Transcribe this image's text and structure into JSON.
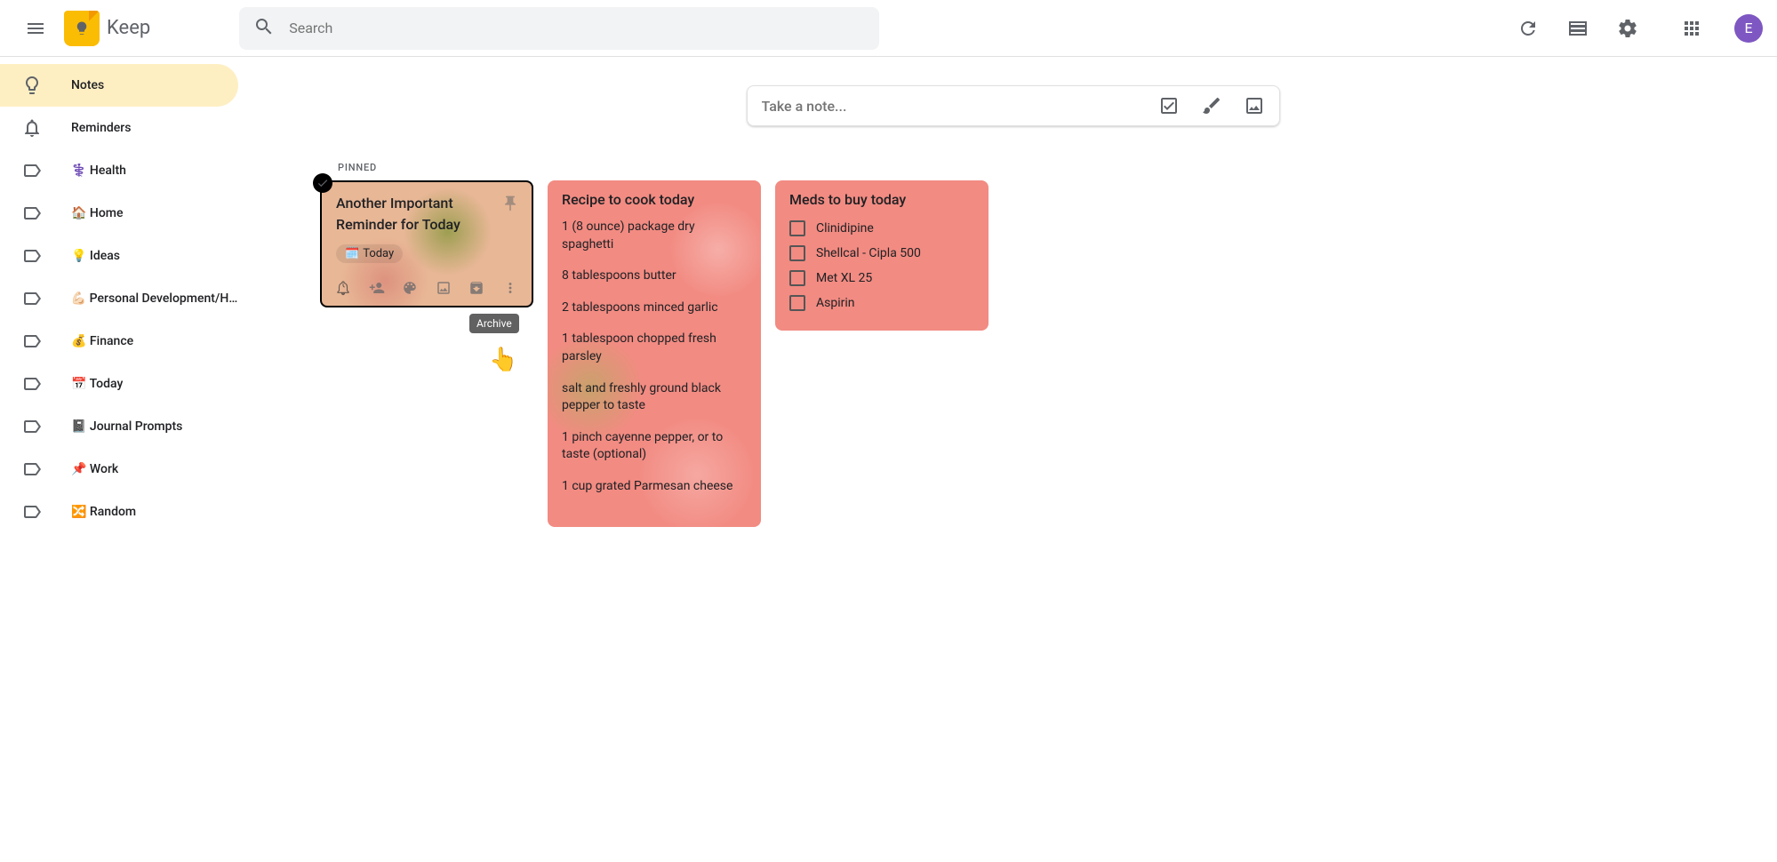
{
  "header": {
    "app_name": "Keep",
    "search_placeholder": "Search",
    "avatar_letter": "E"
  },
  "sidebar": {
    "items": [
      {
        "label": "Notes"
      },
      {
        "label": "Reminders"
      },
      {
        "label": "⚕️ Health"
      },
      {
        "label": "🏠 Home"
      },
      {
        "label": "💡 Ideas"
      },
      {
        "label": "💪🏻 Personal Development/H..."
      },
      {
        "label": "💰 Finance"
      },
      {
        "label": "📅 Today"
      },
      {
        "label": "📓 Journal Prompts"
      },
      {
        "label": "📌 Work"
      },
      {
        "label": "🔀 Random"
      }
    ]
  },
  "compose": {
    "placeholder": "Take a note..."
  },
  "sections": {
    "pinned_label": "PINNED"
  },
  "notes": {
    "n1": {
      "title": "Another Important Reminder for Today",
      "chip": "Today",
      "tooltip": "Archive"
    },
    "n2": {
      "title": "Recipe to cook today",
      "items": [
        "1 (8 ounce) package dry spaghetti",
        "8 tablespoons butter",
        "2 tablespoons minced garlic",
        "1 tablespoon chopped fresh parsley",
        "salt and freshly ground black pepper to taste",
        "1 pinch cayenne pepper, or to taste (optional)",
        "1 cup grated Parmesan cheese"
      ]
    },
    "n3": {
      "title": "Meds to buy today",
      "items": [
        "Clinidipine",
        "Shellcal - Cipla 500",
        "Met XL 25",
        "Aspirin"
      ]
    }
  }
}
